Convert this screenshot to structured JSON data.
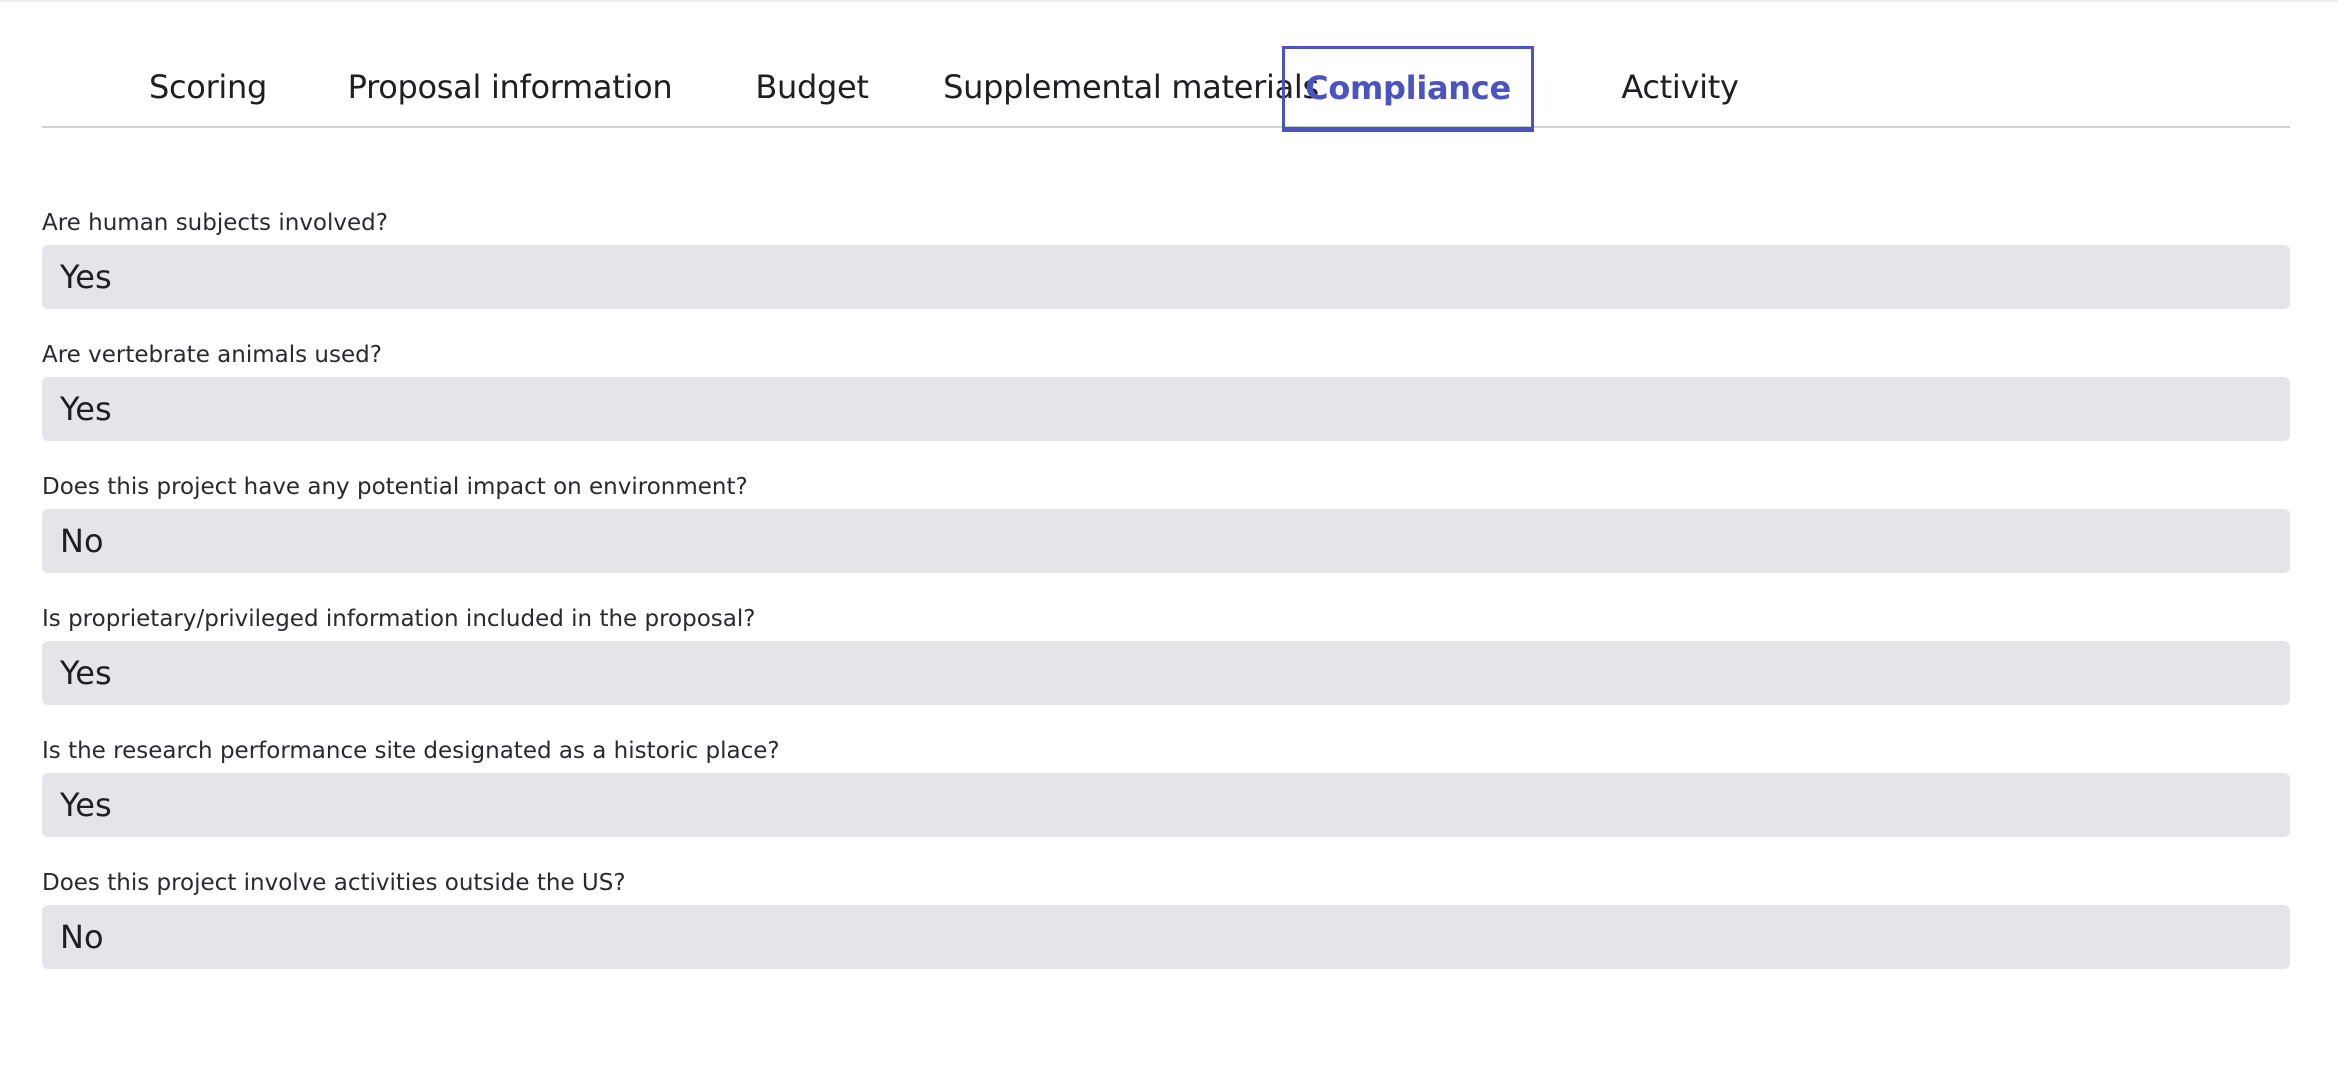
{
  "tabs": [
    {
      "label": "Scoring"
    },
    {
      "label": "Proposal information"
    },
    {
      "label": "Budget"
    },
    {
      "label": "Supplemental materials"
    },
    {
      "label": "Compliance",
      "active": true
    },
    {
      "label": "Activity"
    }
  ],
  "colors": {
    "accent": "#4b53bf",
    "field_background": "#e4e5e9"
  },
  "compliance": {
    "questions": [
      {
        "label": "Are human subjects involved?",
        "value": "Yes"
      },
      {
        "label": "Are vertebrate animals used?",
        "value": "Yes"
      },
      {
        "label": "Does this project have any potential impact on environment?",
        "value": "No"
      },
      {
        "label": "Is proprietary/privileged information included in the proposal?",
        "value": "Yes"
      },
      {
        "label": "Is the research performance site designated as a historic place?",
        "value": "Yes"
      },
      {
        "label": "Does this project involve activities outside the US?",
        "value": "No"
      }
    ]
  }
}
